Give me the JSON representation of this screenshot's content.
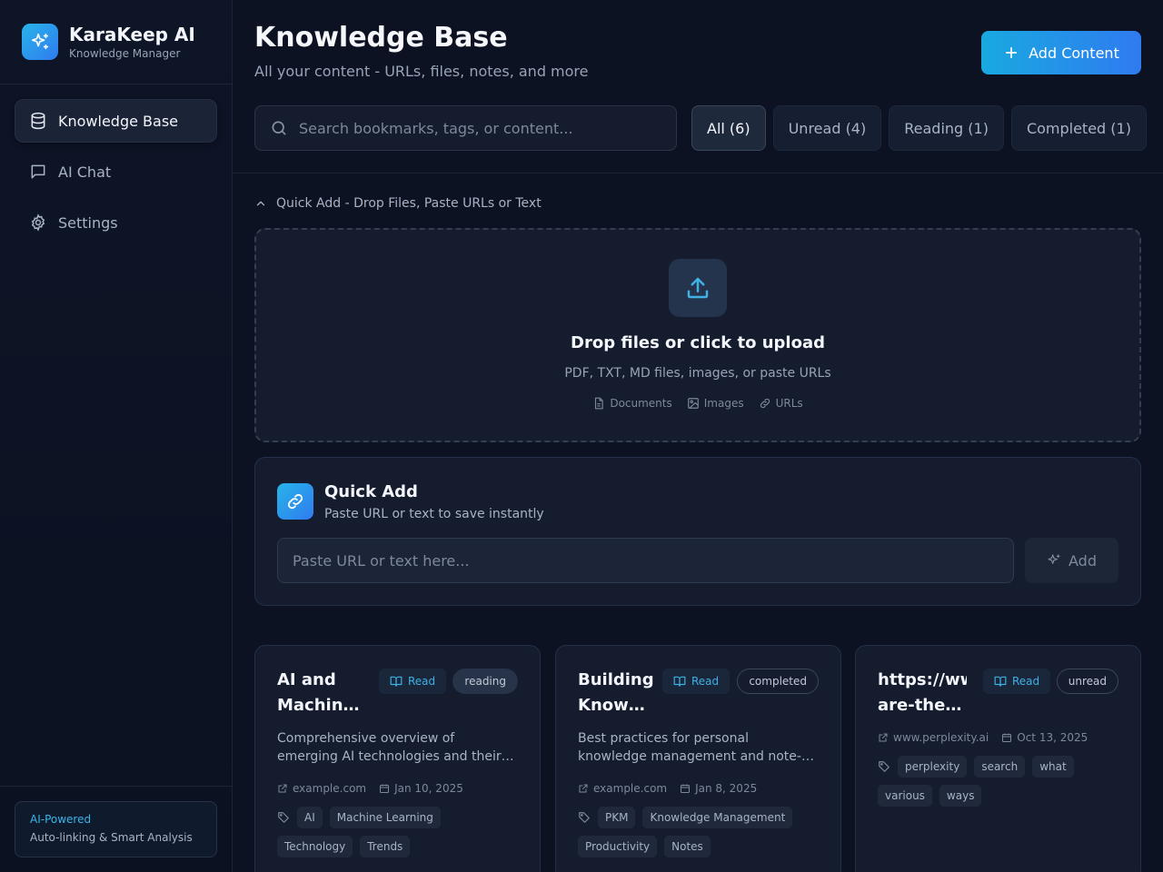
{
  "brand": {
    "title": "KaraKeep AI",
    "subtitle": "Knowledge Manager"
  },
  "nav": [
    {
      "label": "Knowledge Base",
      "icon": "database-icon",
      "active": true
    },
    {
      "label": "AI Chat",
      "icon": "chat-icon",
      "active": false
    },
    {
      "label": "Settings",
      "icon": "gear-icon",
      "active": false
    }
  ],
  "sidebar_footer": {
    "title": "AI-Powered",
    "subtitle": "Auto-linking & Smart Analysis"
  },
  "header": {
    "title": "Knowledge Base",
    "subtitle": "All your content - URLs, files, notes, and more",
    "add_label": "Add Content"
  },
  "search": {
    "placeholder": "Search bookmarks, tags, or content..."
  },
  "filters": [
    {
      "label": "All (6)",
      "active": true
    },
    {
      "label": "Unread (4)",
      "active": false
    },
    {
      "label": "Reading (1)",
      "active": false
    },
    {
      "label": "Completed (1)",
      "active": false
    }
  ],
  "quick_toggle": {
    "label": "Quick Add - Drop Files, Paste URLs or Text"
  },
  "dropzone": {
    "title": "Drop files or click to upload",
    "subtitle": "PDF, TXT, MD files, images, or paste URLs",
    "types": [
      {
        "label": "Documents",
        "icon": "document-icon"
      },
      {
        "label": "Images",
        "icon": "image-icon"
      },
      {
        "label": "URLs",
        "icon": "link-icon"
      }
    ]
  },
  "quick_add": {
    "title": "Quick Add",
    "subtitle": "Paste URL or text to save instantly",
    "placeholder": "Paste URL or text here...",
    "add_label": "Add"
  },
  "cards": [
    {
      "title_line1": "AI and",
      "title_line2": "Machin…",
      "read_label": "Read",
      "status": "reading",
      "desc_line1": "Comprehensive overview of",
      "desc_line2": "emerging AI technologies and their…",
      "domain": "example.com",
      "date": "Jan 10, 2025",
      "tags": [
        "AI",
        "Machine Learning",
        "Technology",
        "Trends"
      ]
    },
    {
      "title_line1": "Building",
      "title_line2": "Know…",
      "read_label": "Read",
      "status": "completed",
      "desc_line1": "Best practices for personal",
      "desc_line2": "knowledge management and note-…",
      "domain": "example.com",
      "date": "Jan 8, 2025",
      "tags": [
        "PKM",
        "Knowledge Management",
        "Productivity",
        "Notes"
      ]
    },
    {
      "title_line1": "https://ww",
      "title_line2": "are-the…",
      "read_label": "Read",
      "status": "unread",
      "desc_line1": "",
      "desc_line2": "",
      "domain": "www.perplexity.ai",
      "date": "Oct 13, 2025",
      "tags": [
        "perplexity",
        "search",
        "what",
        "various",
        "ways"
      ]
    }
  ],
  "colors": {
    "accent": "#28b4e8",
    "accent2": "#2f7bf0",
    "bg": "#0c1222",
    "card": "#141c2e"
  }
}
